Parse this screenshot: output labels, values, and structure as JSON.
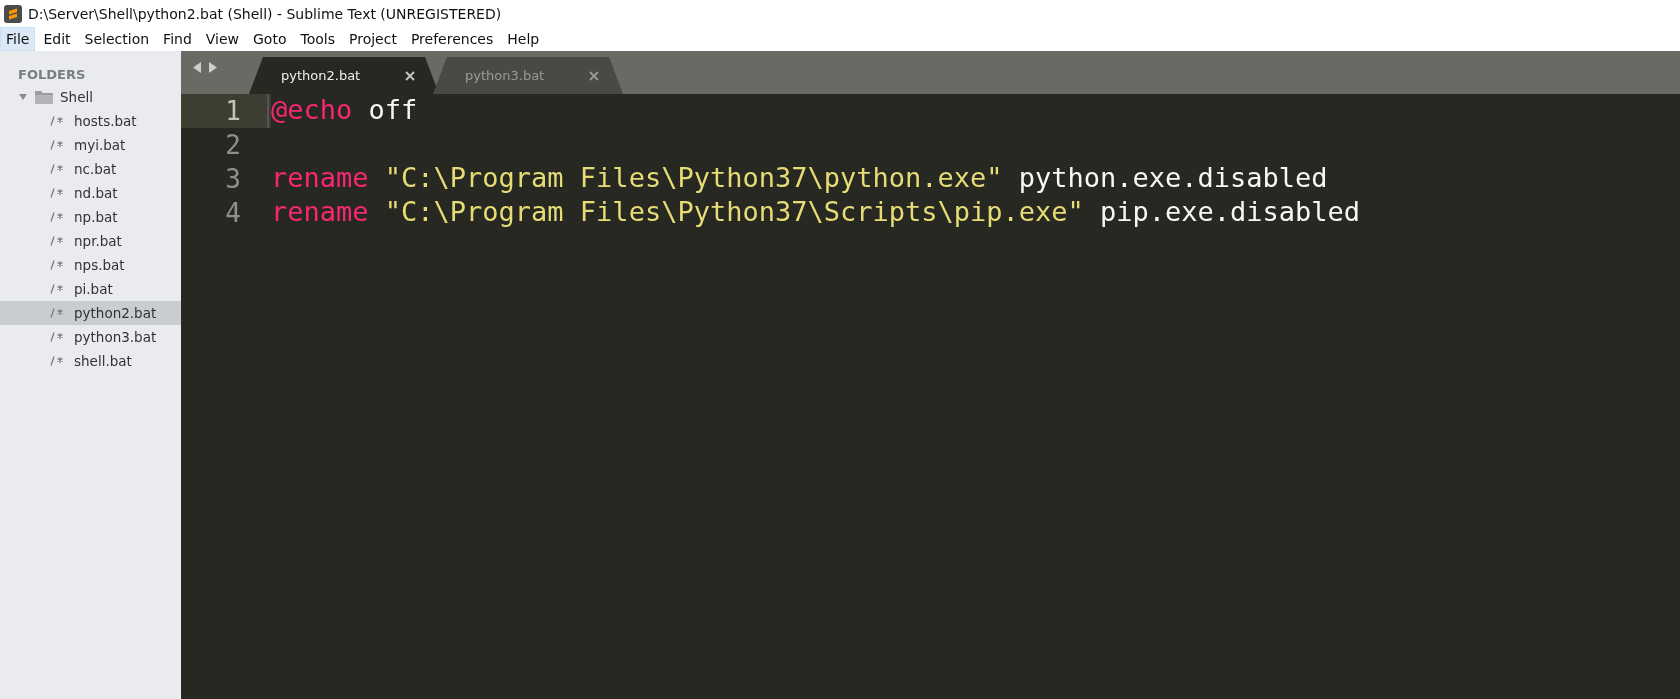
{
  "window": {
    "title": "D:\\Server\\Shell\\python2.bat (Shell) - Sublime Text (UNREGISTERED)"
  },
  "menu": [
    {
      "label": "File",
      "selected": true
    },
    {
      "label": "Edit",
      "selected": false
    },
    {
      "label": "Selection",
      "selected": false
    },
    {
      "label": "Find",
      "selected": false
    },
    {
      "label": "View",
      "selected": false
    },
    {
      "label": "Goto",
      "selected": false
    },
    {
      "label": "Tools",
      "selected": false
    },
    {
      "label": "Project",
      "selected": false
    },
    {
      "label": "Preferences",
      "selected": false
    },
    {
      "label": "Help",
      "selected": false
    }
  ],
  "sidebar": {
    "heading": "FOLDERS",
    "folder": {
      "name": "Shell",
      "expanded": true,
      "children": [
        {
          "name": "hosts.bat",
          "selected": false
        },
        {
          "name": "myi.bat",
          "selected": false
        },
        {
          "name": "nc.bat",
          "selected": false
        },
        {
          "name": "nd.bat",
          "selected": false
        },
        {
          "name": "np.bat",
          "selected": false
        },
        {
          "name": "npr.bat",
          "selected": false
        },
        {
          "name": "nps.bat",
          "selected": false
        },
        {
          "name": "pi.bat",
          "selected": false
        },
        {
          "name": "python2.bat",
          "selected": true
        },
        {
          "name": "python3.bat",
          "selected": false
        },
        {
          "name": "shell.bat",
          "selected": false
        }
      ]
    }
  },
  "tabs": [
    {
      "label": "python2.bat",
      "selected": true
    },
    {
      "label": "python3.bat",
      "selected": false
    }
  ],
  "editor": {
    "lines": [
      {
        "number": "1",
        "current": true,
        "tokens": [
          {
            "kind": "keyword",
            "text": "@echo"
          },
          {
            "kind": "plain",
            "text": " off"
          }
        ]
      },
      {
        "number": "2",
        "current": false
      },
      {
        "number": "3",
        "current": false,
        "tokens": [
          {
            "kind": "keyword",
            "text": "rename "
          },
          {
            "kind": "string",
            "text": "\"C:\\Program Files\\Python37\\python.exe\""
          },
          {
            "kind": "plain",
            "text": " python.exe.disabled"
          }
        ]
      },
      {
        "number": "4",
        "current": false,
        "tokens": [
          {
            "kind": "keyword",
            "text": "rename "
          },
          {
            "kind": "string",
            "text": "\"C:\\Program Files\\Python37\\Scripts\\pip.exe\""
          },
          {
            "kind": "plain",
            "text": " pip.exe.disabled"
          }
        ]
      }
    ]
  }
}
